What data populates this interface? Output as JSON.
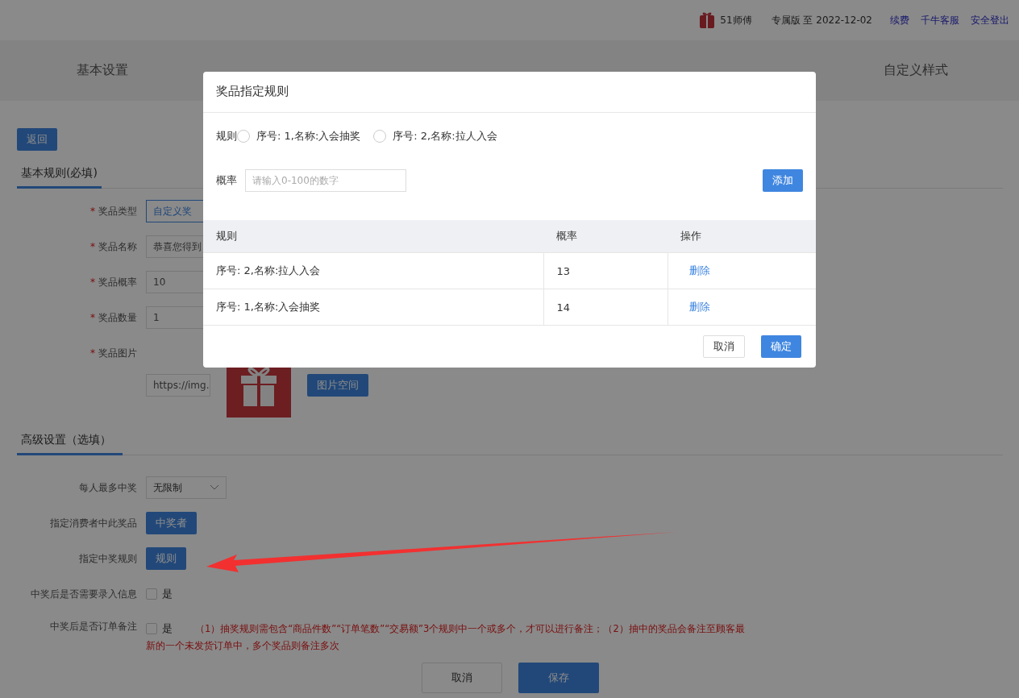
{
  "header": {
    "brand": "51师傅",
    "edition": "专属版 至 2022-12-02",
    "links": [
      "续费",
      "千牛客服",
      "安全登出"
    ]
  },
  "nav_tabs": [
    {
      "label": "基本设置",
      "selected": false
    },
    {
      "label": "自定义样式",
      "selected": false
    }
  ],
  "back_button": "返回",
  "basic_section": {
    "title": "基本规则(必填)",
    "fields": [
      {
        "kind": "select",
        "required_mark": "*",
        "label": "奖品类型",
        "value": "自定义奖"
      },
      {
        "kind": "input",
        "required_mark": "*",
        "label": "奖品名称",
        "value": "恭喜您得到"
      },
      {
        "kind": "input",
        "required_mark": "*",
        "label": "奖品概率",
        "value": "10"
      },
      {
        "kind": "input",
        "required_mark": "*",
        "label": "奖品数量",
        "value": "1"
      },
      {
        "required_mark": "*",
        "label": "奖品图片",
        "value": "https://img.",
        "button": "图片空间"
      }
    ]
  },
  "advanced_section": {
    "title": "高级设置（选填）",
    "fields": [
      {
        "kind": "select",
        "label": "每人最多中奖",
        "value": "无限制"
      },
      {
        "kind": "button",
        "label": "指定消费者中此奖品",
        "button": "中奖者"
      },
      {
        "kind": "button",
        "label": "指定中奖规则",
        "button": "规则"
      },
      {
        "kind": "checkbox",
        "label": "中奖后是否需要录入信息",
        "option": "是",
        "checked": false
      },
      {
        "kind": "checkbox",
        "label": "中奖后是否订单备注",
        "option": "是",
        "checked": false,
        "note_lines": [
          "（1）抽奖规则需包含“商品件数”“订单笔数”“交易额”3个规则中一个或多个，才可以进行备注；（2）抽中的奖品会备注至顾客最",
          "新的一个未发货订单中，多个奖品则备注多次"
        ]
      }
    ]
  },
  "footer_buttons": [
    {
      "label": "取消",
      "kind": "secondary"
    },
    {
      "label": "保存",
      "kind": "primary"
    }
  ],
  "dialog": {
    "title": "奖品指定规则",
    "rule_label": "规则",
    "rule_options": [
      {
        "label": "序号: 1,名称:入会抽奖",
        "selected": false
      },
      {
        "label": "序号: 2,名称:拉人入会",
        "selected": false
      }
    ],
    "rate_label": "概率",
    "rate_placeholder": "请输入0-100的数字",
    "add_button": "添加",
    "table": {
      "columns": [
        "规则",
        "概率",
        "操作"
      ],
      "rows": [
        {
          "rule": "序号: 2,名称:拉人入会",
          "rate": "13",
          "action": "删除"
        },
        {
          "rule": "序号: 1,名称:入会抽奖",
          "rate": "14",
          "action": "删除"
        }
      ]
    },
    "buttons": [
      {
        "label": "取消",
        "kind": "secondary"
      },
      {
        "label": "确定",
        "kind": "primary"
      }
    ]
  }
}
